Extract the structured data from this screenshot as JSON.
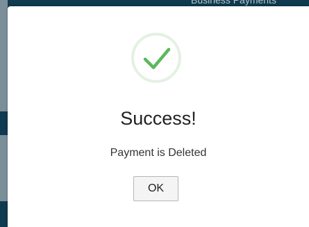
{
  "backdrop": {
    "text": "Business Payments"
  },
  "dialog": {
    "icon": "check-icon",
    "title": "Success!",
    "message": "Payment is Deleted",
    "ok_label": "OK"
  },
  "colors": {
    "success_green": "#5cb85c",
    "ring": "#e4f1e2",
    "backdrop": "#0f3a4f"
  }
}
